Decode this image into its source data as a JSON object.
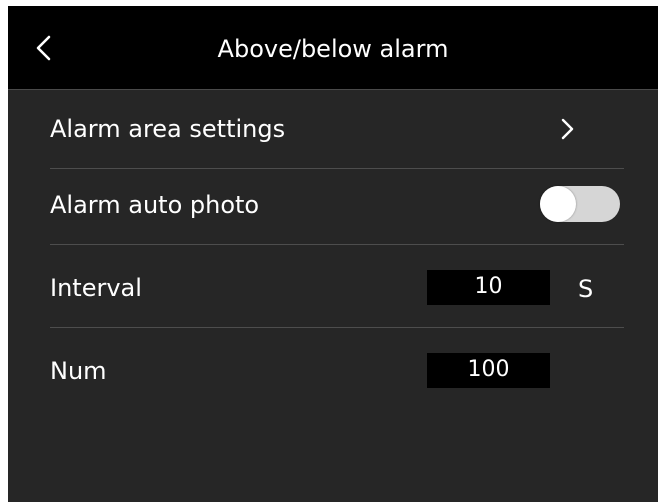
{
  "header": {
    "title": "Above/below alarm",
    "back_icon": "chevron-left-icon"
  },
  "rows": {
    "alarm_area": {
      "label": "Alarm area settings",
      "icon": "chevron-right-icon"
    },
    "auto_photo": {
      "label": "Alarm auto photo",
      "toggle_on": false
    },
    "interval": {
      "label": "Interval",
      "value": "10",
      "unit": "S"
    },
    "num": {
      "label": "Num",
      "value": "100"
    }
  },
  "colors": {
    "background": "#262626",
    "header": "#000000",
    "divider": "#4d4d4d",
    "input_bg": "#000000",
    "toggle_track": "#d6d6d6",
    "text": "#ffffff"
  }
}
